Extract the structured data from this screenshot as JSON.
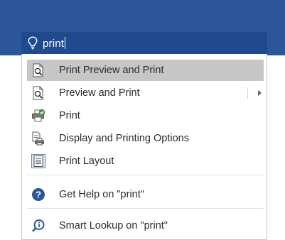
{
  "search": {
    "query": "print"
  },
  "menu": {
    "items": [
      {
        "label": "Print Preview and Print",
        "icon": "print-preview-icon",
        "highlighted": true
      },
      {
        "label": "Preview and Print",
        "icon": "print-preview-icon",
        "has_submenu": true
      },
      {
        "label": "Print",
        "icon": "printer-check-icon"
      },
      {
        "label": "Display and Printing Options",
        "icon": "printing-options-icon"
      },
      {
        "label": "Print Layout",
        "icon": "print-layout-icon"
      },
      {
        "label": "Get Help on \"print\"",
        "icon": "help-icon"
      },
      {
        "label": "Smart Lookup on \"print\"",
        "icon": "smart-lookup-icon"
      }
    ]
  },
  "colors": {
    "ribbon": "#2b579a",
    "search_bg": "#1f4b8e",
    "highlight": "#c6c6c6",
    "help_blue": "#2b579a"
  }
}
